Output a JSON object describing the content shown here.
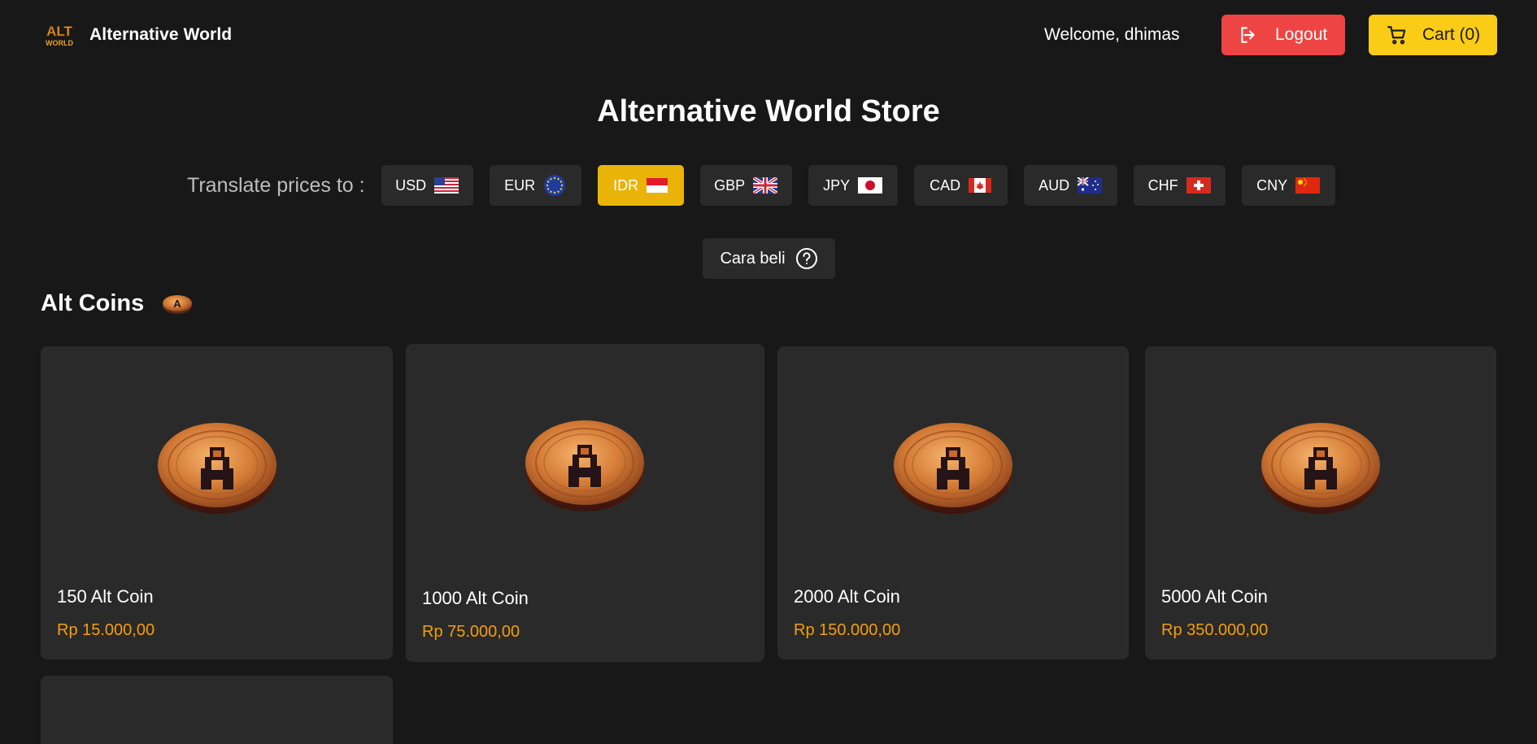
{
  "header": {
    "brand_name": "Alternative World",
    "logo_text_top": "ALT",
    "logo_text_bottom": "WORLD",
    "welcome": "Welcome, dhimas",
    "logout_label": "Logout",
    "cart_label": "Cart (0)"
  },
  "store_title": "Alternative World Store",
  "currency": {
    "label": "Translate prices to :",
    "selected": "IDR",
    "options": [
      "USD",
      "EUR",
      "IDR",
      "GBP",
      "JPY",
      "CAD",
      "AUD",
      "CHF",
      "CNY"
    ]
  },
  "how_to_buy": {
    "label": "Cara beli",
    "icon": "question-circle-icon"
  },
  "section": {
    "title": "Alt Coins"
  },
  "products": [
    {
      "name": "150 Alt Coin",
      "price": "Rp 15.000,00"
    },
    {
      "name": "1000 Alt Coin",
      "price": "Rp 75.000,00"
    },
    {
      "name": "2000 Alt Coin",
      "price": "Rp 150.000,00"
    },
    {
      "name": "5000 Alt Coin",
      "price": "Rp 350.000,00"
    }
  ],
  "colors": {
    "background": "#181818",
    "card": "#2a2a2a",
    "logout": "#ef4444",
    "cart": "#facc15",
    "active_currency": "#eab308",
    "price": "#f59e0b"
  },
  "icons": [
    "logout-icon",
    "cart-icon",
    "coin-icon",
    "question-circle-icon"
  ]
}
